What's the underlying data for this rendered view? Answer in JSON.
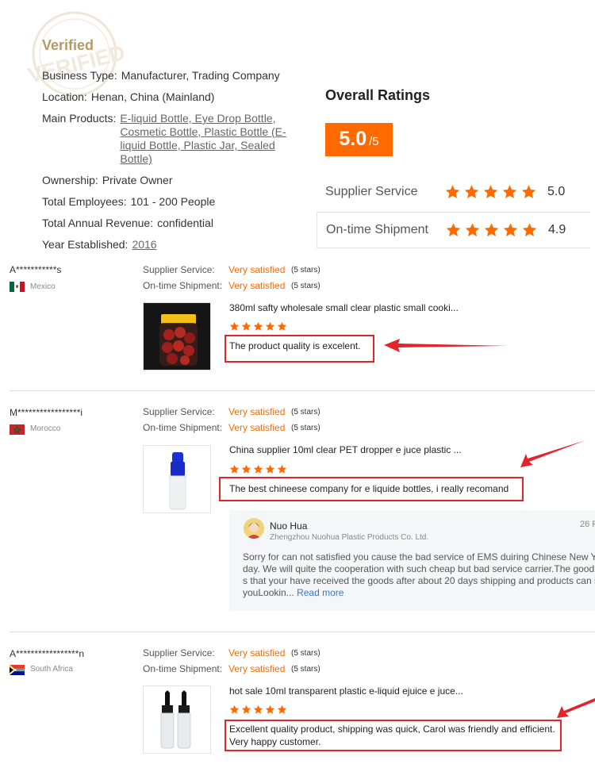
{
  "verified": {
    "title": "Verified",
    "watermark_text": "VERIFIED",
    "business_type_label": "Business Type:",
    "business_type": "Manufacturer, Trading Company",
    "location_label": "Location:",
    "location": "Henan, China (Mainland)",
    "main_products_label": "Main Products:",
    "main_products": [
      "E-liquid Bottle,",
      "Eye Drop Bottle,",
      "Cosmetic Bottle,",
      "Plastic Bottle (E-liquid Bottle,",
      "Plastic Jar,",
      "Sealed Bottle)"
    ],
    "ownership_label": "Ownership:",
    "ownership": "Private Owner",
    "employees_label": "Total Employees:",
    "employees": "101 - 200 People",
    "revenue_label": "Total Annual Revenue:",
    "revenue": "confidential",
    "established_label": "Year Established:",
    "established": "2016"
  },
  "overall": {
    "title": "Overall Ratings",
    "score": "5.0",
    "out_of": "/5",
    "rows": [
      {
        "label": "Supplier Service",
        "value": "5.0",
        "stars": 5
      },
      {
        "label": "On-time Shipment",
        "value": "4.9",
        "stars": 5
      }
    ]
  },
  "colors": {
    "accent": "#ff6a00",
    "highlight": "#e0262c",
    "link": "#2a7ad8"
  },
  "reviews": [
    {
      "buyer": "A***********s",
      "country": "Mexico",
      "service_label": "Supplier Service:",
      "service_value": "Very satisfied",
      "service_stars": "(5 stars)",
      "shipment_label": "On-time Shipment:",
      "shipment_value": "Very satisfied",
      "shipment_stars": "(5 stars)",
      "product_title": "380ml safty wholesale small clear plastic small cooki...",
      "rating": 5,
      "comment": "The product quality is excelent."
    },
    {
      "buyer": "M*****************i",
      "country": "Morocco",
      "service_label": "Supplier Service:",
      "service_value": "Very satisfied",
      "service_stars": "(5 stars)",
      "shipment_label": "On-time Shipment:",
      "shipment_value": "Very satisfied",
      "shipment_stars": "(5 stars)",
      "product_title": "China supplier 10ml clear PET dropper e juce plastic ...",
      "rating": 5,
      "comment": "The best chineese company for e liquide bottles, i really recomand",
      "reply": {
        "name": "Nuo Hua",
        "company": "Zhengzhou Nuohua Plastic Products Co. Ltd.",
        "date": "26 F",
        "text": "Sorry for can not satisfied you cause the bad service of EMS duiring Chinese New Ye\nday. We will quite the cooperation with such cheap but bad service carrier.The good\ns that your have received the goods after about 20 days shipping and products can s\n youLookin...",
        "more": "Read more"
      }
    },
    {
      "buyer": "A*****************n",
      "country": "South Africa",
      "service_label": "Supplier Service:",
      "service_value": "Very satisfied",
      "service_stars": "(5 stars)",
      "shipment_label": "On-time Shipment:",
      "shipment_value": "Very satisfied",
      "shipment_stars": "(5 stars)",
      "product_title": "hot sale 10ml transparent plastic e-liquid ejuice e juce...",
      "rating": 5,
      "comment_line1": "Excellent quality product, shipping was quick, Carol was friendly and efficient.",
      "comment_line2": "Very happy customer."
    }
  ]
}
